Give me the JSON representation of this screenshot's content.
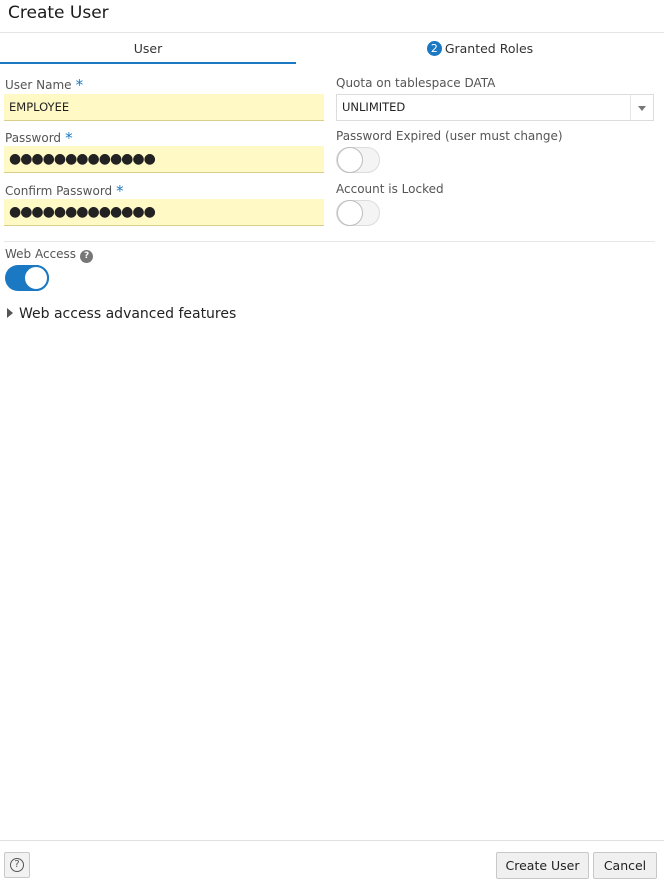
{
  "dialog": {
    "title": "Create User"
  },
  "tabs": [
    {
      "label": "User",
      "selected": true
    },
    {
      "badge": "2",
      "label": "Granted Roles",
      "selected": false
    }
  ],
  "form": {
    "user_name": {
      "label": "User Name",
      "required_mark": "*",
      "value": "EMPLOYEE"
    },
    "password": {
      "label": "Password",
      "required_mark": "*",
      "masked_value": "●●●●●●●●●●●●●"
    },
    "confirm_password": {
      "label": "Confirm Password",
      "required_mark": "*",
      "masked_value": "●●●●●●●●●●●●●"
    },
    "quota": {
      "label": "Quota on tablespace DATA",
      "value": "UNLIMITED"
    },
    "password_expired": {
      "label": "Password Expired (user must change)",
      "on": false
    },
    "account_locked": {
      "label": "Account is Locked",
      "on": false
    },
    "web_access": {
      "label": "Web Access",
      "help_icon": "?",
      "on": true
    },
    "advanced": {
      "label": "Web access advanced features",
      "expanded": false
    }
  },
  "footer": {
    "help_icon": "?",
    "create_label": "Create User",
    "cancel_label": "Cancel"
  },
  "colors": {
    "accent": "#1b78c2",
    "field_bg": "#fff9c6"
  }
}
